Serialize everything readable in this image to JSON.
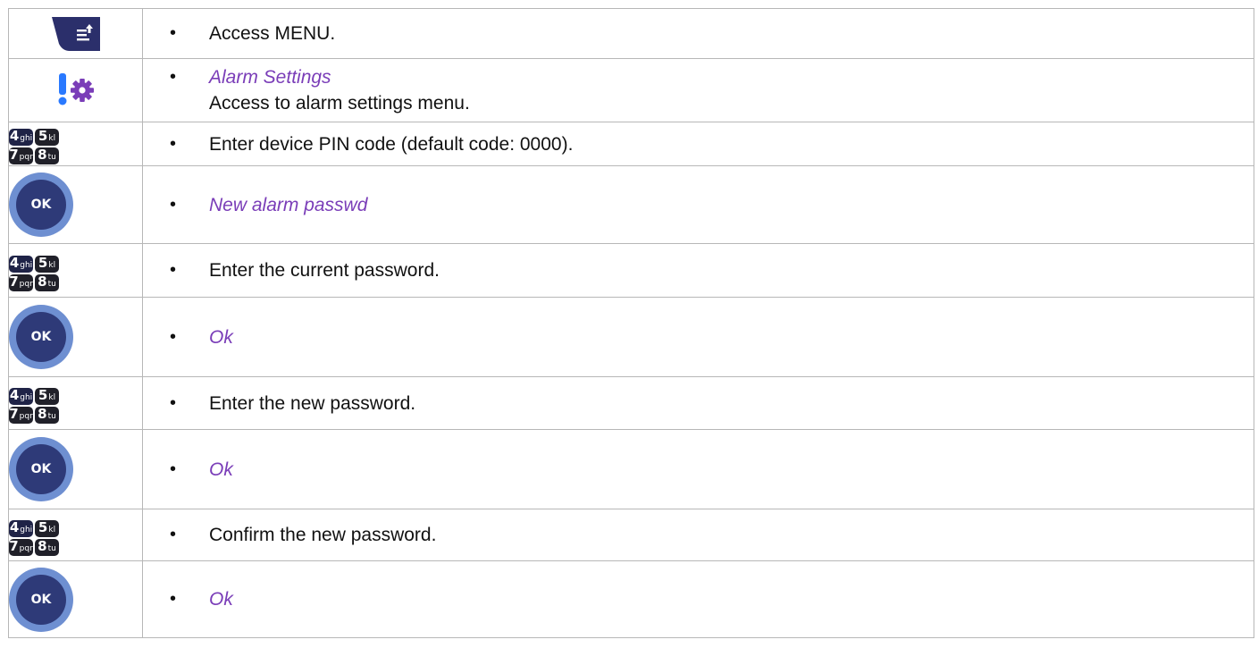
{
  "colors": {
    "italic_text": "#7a3db8",
    "border": "#b7b7b7",
    "ok_outer": "#6e8fd1",
    "ok_inner": "#2e3a78",
    "menu_key": "#2b2f6b",
    "alarm_icon": "#2979ff",
    "gear": "#7a3db8"
  },
  "keypad": {
    "k1": {
      "num": "4",
      "ltr": "ghi"
    },
    "k2": {
      "num": "5",
      "ltr": "kl"
    },
    "k3": {
      "num": "7",
      "ltr": "pqr"
    },
    "k4": {
      "num": "8",
      "ltr": "tu"
    }
  },
  "ok_label": "OK",
  "rows": [
    {
      "icon": "menu-key-icon",
      "text": "Access MENU."
    },
    {
      "icon": "alarm-settings-icon",
      "text": "Alarm Settings",
      "sub": "Access to alarm settings menu."
    },
    {
      "icon": "keypad-icon",
      "text": "Enter device PIN code (default code: 0000)."
    },
    {
      "icon": "ok-button-icon",
      "text": "New alarm passwd"
    },
    {
      "icon": "keypad-icon",
      "text": "Enter the current password."
    },
    {
      "icon": "ok-button-icon",
      "text": "Ok"
    },
    {
      "icon": "keypad-icon",
      "text": "Enter the new password."
    },
    {
      "icon": "ok-button-icon",
      "text": "Ok"
    },
    {
      "icon": "keypad-icon",
      "text": "Confirm the new password."
    },
    {
      "icon": "ok-button-icon",
      "text": "Ok"
    }
  ]
}
